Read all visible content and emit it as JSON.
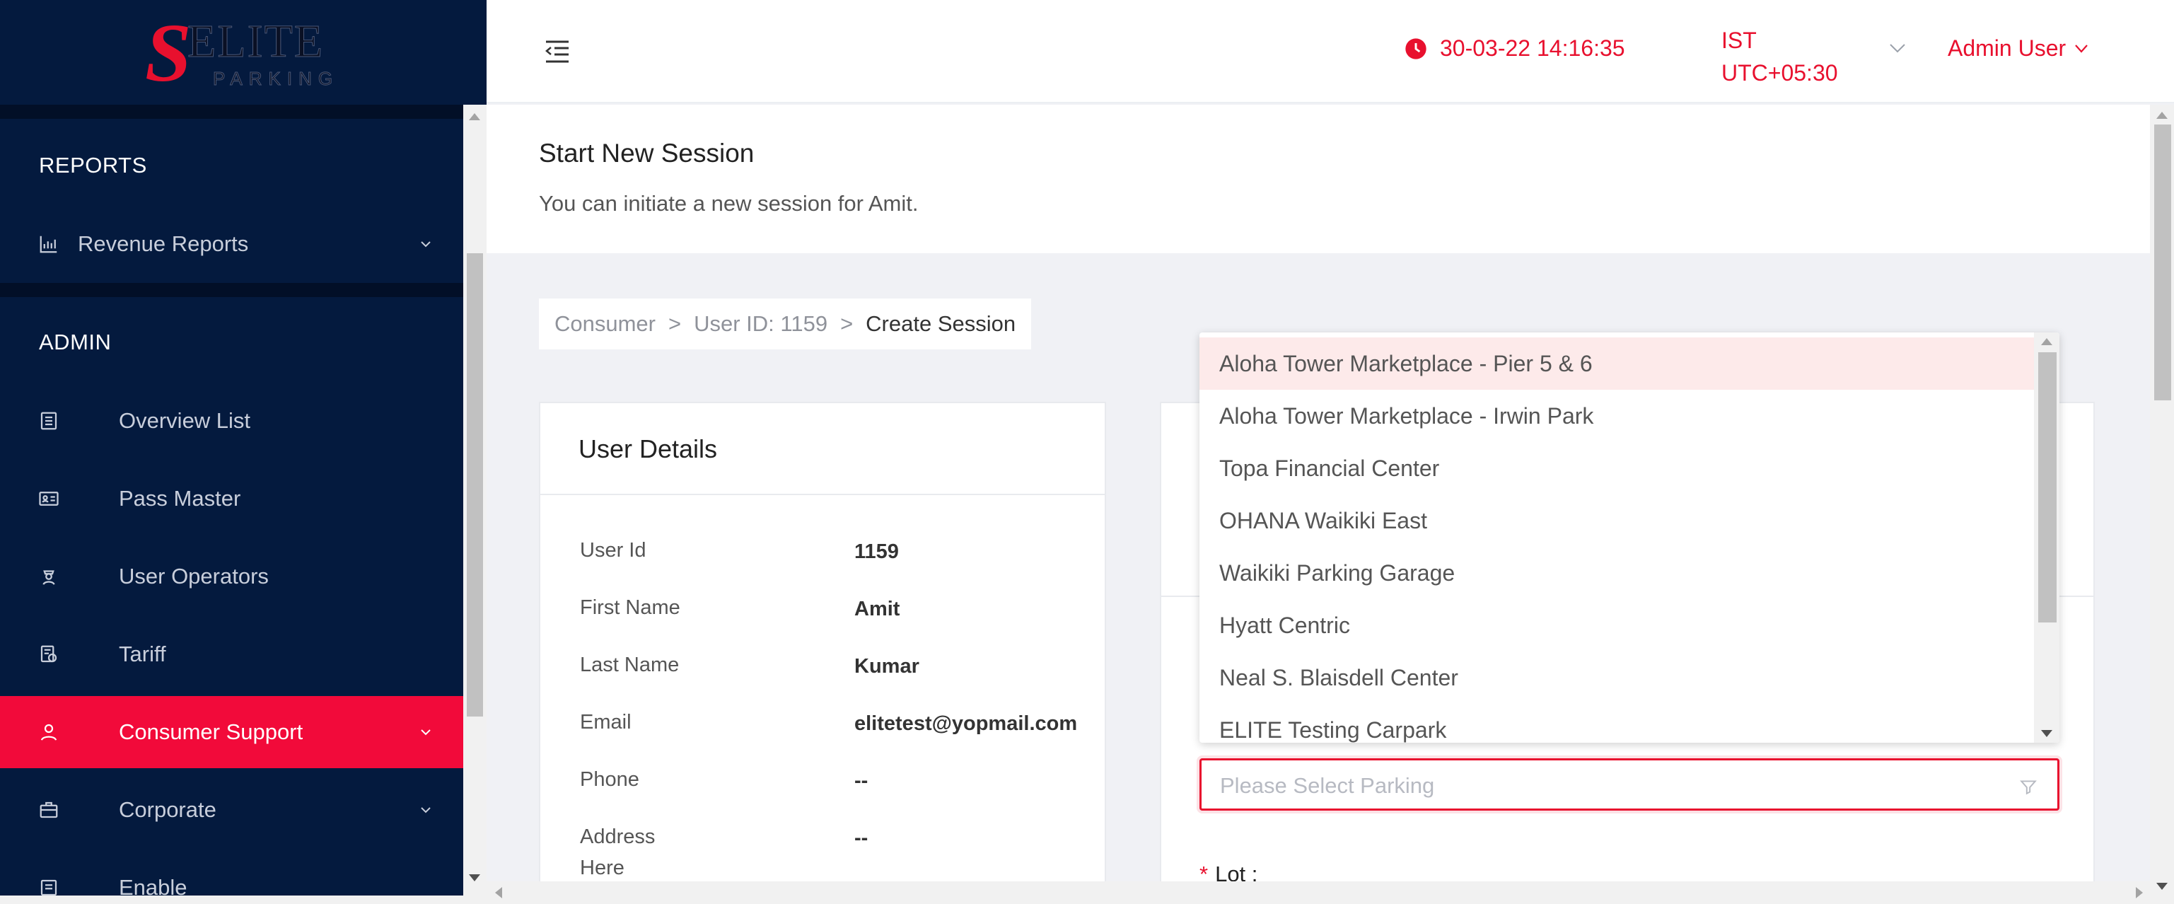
{
  "brand": {
    "logo_letter": "S",
    "logo_word": "ELITE",
    "logo_sub": "PARKING",
    "accent": "#e8102e",
    "sidebar_bg": "#041a3e"
  },
  "sidebar": {
    "sections": [
      {
        "title": "REPORTS",
        "items": [
          {
            "label": "Revenue Reports",
            "icon": "bar-chart-icon",
            "expandable": true
          }
        ]
      },
      {
        "title": "ADMIN",
        "items": [
          {
            "label": "Overview List",
            "icon": "list-icon"
          },
          {
            "label": "Pass Master",
            "icon": "id-card-icon"
          },
          {
            "label": "User Operators",
            "icon": "operator-icon"
          },
          {
            "label": "Tariff",
            "icon": "tariff-icon"
          },
          {
            "label": "Consumer Support",
            "icon": "user-icon",
            "expandable": true,
            "active": true
          },
          {
            "label": "Corporate",
            "icon": "briefcase-icon",
            "expandable": true
          },
          {
            "label": "Enable",
            "icon": "enable-icon"
          }
        ]
      }
    ]
  },
  "header": {
    "datetime": "30-03-22 14:16:35",
    "timezone_line1": "IST",
    "timezone_line2": "UTC+05:30",
    "user": "Admin User"
  },
  "page": {
    "title": "Start New Session",
    "subtitle": "You can initiate a new session for Amit."
  },
  "breadcrumb": {
    "items": [
      "Consumer",
      "User ID: 1159",
      "Create Session"
    ],
    "separator": ">"
  },
  "user_details": {
    "title": "User Details",
    "fields": [
      {
        "label": "User Id",
        "value": "1159"
      },
      {
        "label": "First Name",
        "value": "Amit"
      },
      {
        "label": "Last Name",
        "value": "Kumar"
      },
      {
        "label": "Email",
        "value": "elitetest@yopmail.com"
      },
      {
        "label": "Phone",
        "value": "--"
      },
      {
        "label": "Address Here",
        "label_line1": "Address",
        "label_line2": "Here",
        "value": "--"
      }
    ]
  },
  "parking_select": {
    "placeholder": "Please Select Parking",
    "options": [
      "Aloha Tower Marketplace - Pier 5 & 6",
      "Aloha Tower Marketplace - Irwin Park",
      "Topa Financial Center",
      "OHANA Waikiki East",
      "Waikiki Parking Garage",
      "Hyatt Centric",
      "Neal S. Blaisdell Center",
      "ELITE Testing Carpark"
    ],
    "highlighted_index": 0
  },
  "lot": {
    "required_mark": "*",
    "label": "Lot :"
  }
}
